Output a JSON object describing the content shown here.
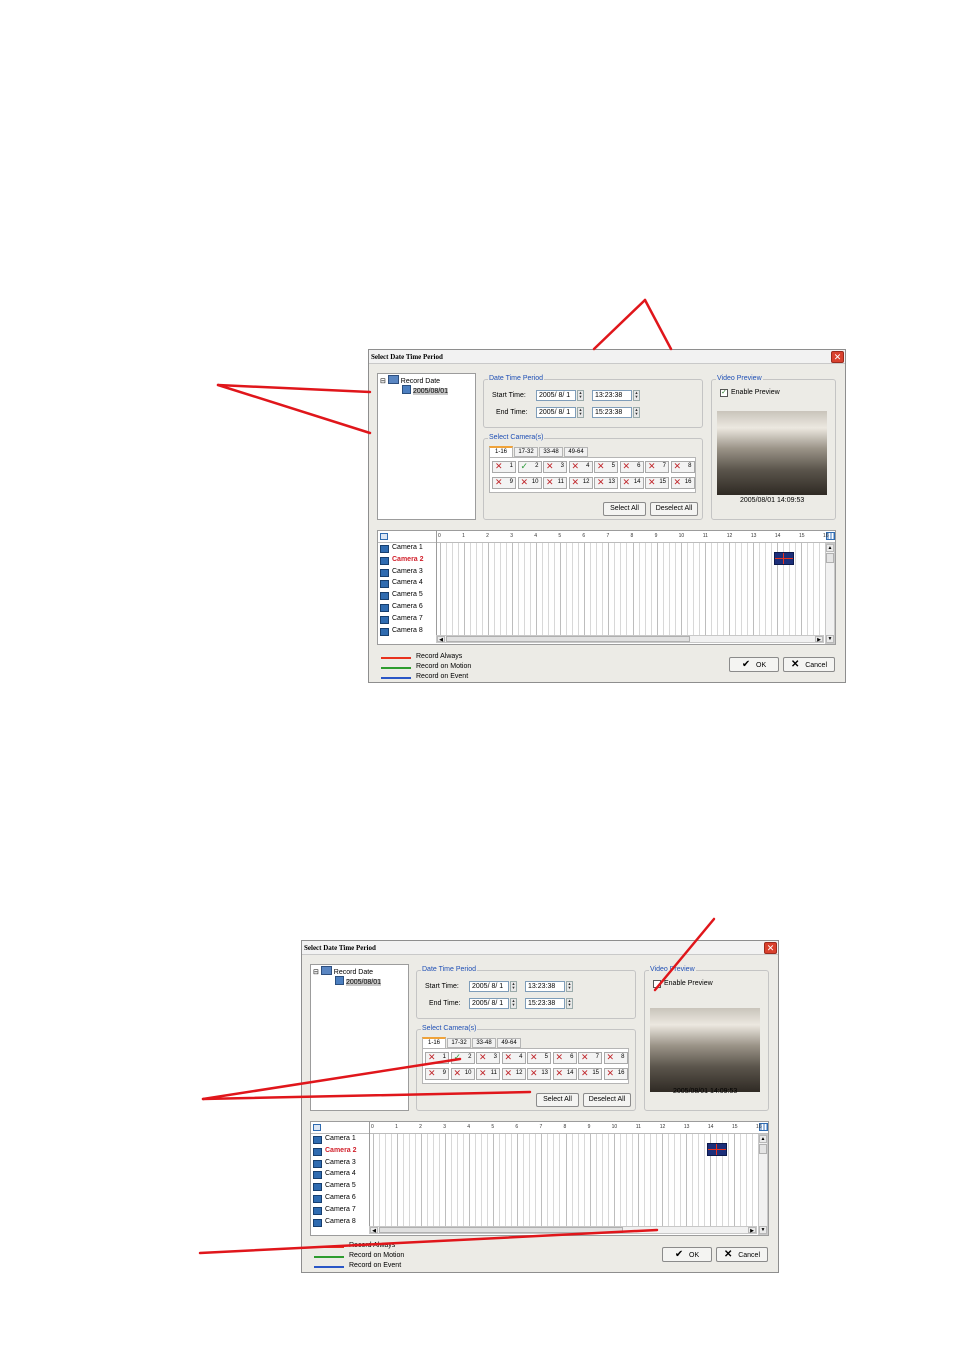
{
  "dialog": {
    "title": "Select Date Time Period",
    "close_icon": "close-icon",
    "tree": {
      "root": "Record Date",
      "child": "2005/08/01"
    },
    "date_time_period": {
      "legend": "Date Time Period",
      "start_label": "Start Time:",
      "start_date": "2005/ 8/ 1",
      "start_time": "13:23:38",
      "end_label": "End Time:",
      "end_date": "2005/ 8/ 1",
      "end_time": "15:23:38"
    },
    "video_preview": {
      "legend": "Video Preview",
      "enable_label": "Enable Preview",
      "enabled_top": true,
      "enabled_bottom": false,
      "timestamp": "2005/08/01 14:09:53"
    },
    "select_cameras": {
      "legend": "Select Camera(s)",
      "tabs": [
        "1-16",
        "17-32",
        "33-48",
        "49-64"
      ],
      "cameras": [
        "1",
        "2",
        "3",
        "4",
        "5",
        "6",
        "7",
        "8",
        "9",
        "10",
        "11",
        "12",
        "13",
        "14",
        "15",
        "16"
      ],
      "checked": "2",
      "select_all": "Select All",
      "deselect_all": "Deselect All"
    },
    "timeline": {
      "hours": [
        "0",
        "1",
        "2",
        "3",
        "4",
        "5",
        "6",
        "7",
        "8",
        "9",
        "10",
        "11",
        "12",
        "13",
        "14",
        "15",
        "16"
      ],
      "rows": [
        "Camera 1",
        "Camera 2",
        "Camera 3",
        "Camera 4",
        "Camera 5",
        "Camera 6",
        "Camera 7",
        "Camera 8"
      ],
      "highlighted_row": "Camera 2",
      "highlight_color": "#d11f2a"
    },
    "legend_items": [
      {
        "label": "Record Always",
        "color": "#e8321e"
      },
      {
        "label": "Record on Motion",
        "color": "#2e9c2e"
      },
      {
        "label": "Record on Event",
        "color": "#2a56c6"
      }
    ],
    "ok": "OK",
    "cancel": "Cancel"
  },
  "annotation_color": "#e0161b"
}
